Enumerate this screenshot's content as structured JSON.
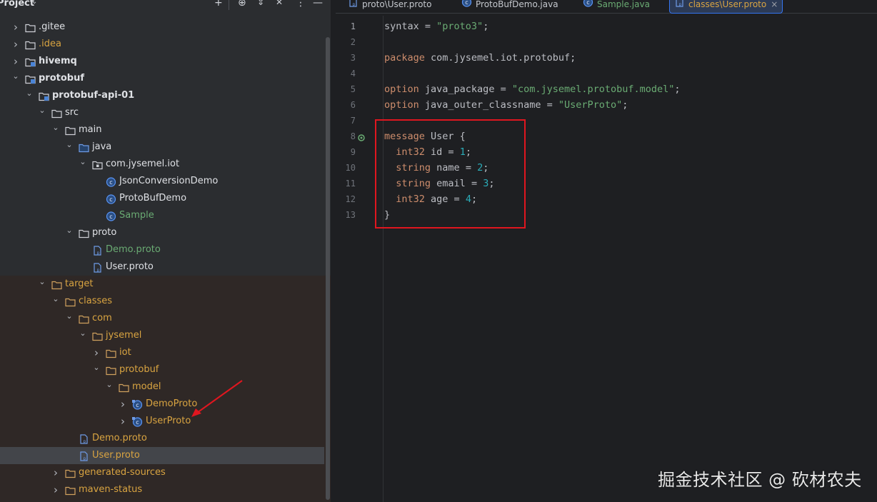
{
  "project_panel": {
    "title": "Project",
    "header_icons": [
      "add-icon",
      "target-icon",
      "expand-all-icon",
      "collapse-all-icon",
      "more-icon",
      "minimize-icon"
    ]
  },
  "tree": [
    {
      "label": ".gitee",
      "icon": "folder-icon",
      "expanded": false,
      "bold": false,
      "color": "#dfe1e5"
    },
    {
      "label": ".idea",
      "icon": "folder-icon",
      "expanded": false,
      "bold": false,
      "color": "#d9a441"
    },
    {
      "label": "hivemq",
      "icon": "module-folder-icon",
      "expanded": false,
      "bold": true,
      "color": "#dfe1e5"
    },
    {
      "label": "protobuf",
      "icon": "module-folder-icon",
      "expanded": true,
      "bold": true,
      "color": "#dfe1e5"
    },
    {
      "label": "protobuf-api-01",
      "icon": "module-folder-icon",
      "expanded": true,
      "bold": true,
      "color": "#dfe1e5"
    },
    {
      "label": "src",
      "icon": "folder-icon",
      "expanded": true,
      "bold": false,
      "color": "#dfe1e5"
    },
    {
      "label": "main",
      "icon": "folder-icon",
      "expanded": true,
      "bold": false,
      "color": "#dfe1e5"
    },
    {
      "label": "java",
      "icon": "source-folder-icon",
      "expanded": true,
      "bold": false,
      "color": "#dfe1e5"
    },
    {
      "label": "com.jysemel.iot",
      "icon": "package-icon",
      "expanded": true,
      "bold": false,
      "color": "#dfe1e5"
    },
    {
      "label": "JsonConversionDemo",
      "icon": "java-class-icon",
      "bold": false,
      "color": "#dfe1e5"
    },
    {
      "label": "ProtoBufDemo",
      "icon": "java-class-icon",
      "bold": false,
      "color": "#dfe1e5"
    },
    {
      "label": "Sample",
      "icon": "java-class-icon",
      "bold": false,
      "color": "#6aab73"
    },
    {
      "label": "proto",
      "icon": "folder-icon",
      "expanded": true,
      "bold": false,
      "color": "#dfe1e5"
    },
    {
      "label": "Demo.proto",
      "icon": "proto-file-icon",
      "bold": false,
      "color": "#6aab73"
    },
    {
      "label": "User.proto",
      "icon": "proto-file-icon",
      "bold": false,
      "color": "#dfe1e5"
    },
    {
      "label": "target",
      "icon": "excluded-folder-icon",
      "expanded": true,
      "bold": false,
      "color": "#d9a441"
    },
    {
      "label": "classes",
      "icon": "excluded-folder-icon",
      "expanded": true,
      "bold": false,
      "color": "#d9a441"
    },
    {
      "label": "com",
      "icon": "excluded-folder-icon",
      "expanded": true,
      "bold": false,
      "color": "#d9a441"
    },
    {
      "label": "jysemel",
      "icon": "excluded-folder-icon",
      "expanded": true,
      "bold": false,
      "color": "#d9a441"
    },
    {
      "label": "iot",
      "icon": "excluded-folder-icon",
      "expanded": false,
      "bold": false,
      "color": "#d9a441"
    },
    {
      "label": "protobuf",
      "icon": "excluded-folder-icon",
      "expanded": true,
      "bold": false,
      "color": "#d9a441"
    },
    {
      "label": "model",
      "icon": "excluded-folder-icon",
      "expanded": true,
      "bold": false,
      "color": "#d9a441"
    },
    {
      "label": "DemoProto",
      "icon": "class-file-icon",
      "expanded": false,
      "bold": false,
      "color": "#d9a441"
    },
    {
      "label": "UserProto",
      "icon": "class-file-icon",
      "expanded": false,
      "bold": false,
      "color": "#d9a441"
    },
    {
      "label": "Demo.proto",
      "icon": "proto-file-icon",
      "bold": false,
      "color": "#d9a441"
    },
    {
      "label": "User.proto",
      "icon": "proto-file-icon",
      "bold": false,
      "color": "#d9a441",
      "selected": true
    },
    {
      "label": "generated-sources",
      "icon": "excluded-folder-icon",
      "expanded": false,
      "bold": false,
      "color": "#d9a441"
    },
    {
      "label": "maven-status",
      "icon": "excluded-folder-icon",
      "expanded": false,
      "bold": false,
      "color": "#d9a441"
    }
  ],
  "editor_tabs": [
    {
      "label": "proto\\User.proto",
      "icon": "proto-file-icon",
      "color": "#c5c8ce",
      "active": false
    },
    {
      "label": "ProtoBufDemo.java",
      "icon": "java-class-icon",
      "color": "#c5c8ce",
      "active": false
    },
    {
      "label": "Sample.java",
      "icon": "java-class-icon",
      "color": "#6aab73",
      "active": false
    },
    {
      "label": "classes\\User.proto",
      "icon": "proto-file-icon",
      "color": "#d9a441",
      "active": true,
      "close": "×"
    }
  ],
  "code_lines": [
    {
      "n": "1",
      "tokens": [
        [
          "t",
          "syntax = "
        ],
        [
          "s",
          "\"proto3\""
        ],
        [
          "t",
          ";"
        ]
      ]
    },
    {
      "n": "2",
      "tokens": []
    },
    {
      "n": "3",
      "tokens": [
        [
          "k",
          "package"
        ],
        [
          "t",
          " com.jysemel.iot.protobuf;"
        ]
      ]
    },
    {
      "n": "4",
      "tokens": []
    },
    {
      "n": "5",
      "tokens": [
        [
          "k",
          "option"
        ],
        [
          "t",
          " java_package = "
        ],
        [
          "s",
          "\"com.jysemel.protobuf.model\""
        ],
        [
          "t",
          ";"
        ]
      ]
    },
    {
      "n": "6",
      "tokens": [
        [
          "k",
          "option"
        ],
        [
          "t",
          " java_outer_classname = "
        ],
        [
          "s",
          "\"UserProto\""
        ],
        [
          "t",
          ";"
        ]
      ]
    },
    {
      "n": "7",
      "tokens": []
    },
    {
      "n": "8",
      "tokens": [
        [
          "k",
          "message"
        ],
        [
          "t",
          " User {"
        ]
      ],
      "gutter_icon": "implemented-icon"
    },
    {
      "n": "9",
      "tokens": [
        [
          "t",
          "  "
        ],
        [
          "k",
          "int32"
        ],
        [
          "t",
          " id = "
        ],
        [
          "n",
          "1"
        ],
        [
          "t",
          ";"
        ]
      ]
    },
    {
      "n": "10",
      "tokens": [
        [
          "t",
          "  "
        ],
        [
          "k",
          "string"
        ],
        [
          "t",
          " name = "
        ],
        [
          "n",
          "2"
        ],
        [
          "t",
          ";"
        ]
      ]
    },
    {
      "n": "11",
      "tokens": [
        [
          "t",
          "  "
        ],
        [
          "k",
          "string"
        ],
        [
          "t",
          " email = "
        ],
        [
          "n",
          "3"
        ],
        [
          "t",
          ";"
        ]
      ]
    },
    {
      "n": "12",
      "tokens": [
        [
          "t",
          "  "
        ],
        [
          "k",
          "int32"
        ],
        [
          "t",
          " age = "
        ],
        [
          "n",
          "4"
        ],
        [
          "t",
          ";"
        ]
      ]
    },
    {
      "n": "13",
      "tokens": [
        [
          "t",
          "}"
        ]
      ]
    }
  ],
  "watermark": "掘金技术社区 @ 砍材农夫",
  "colors": {
    "keyword": "#cf8e6d",
    "string": "#6aab73",
    "number": "#2aacb8",
    "text": "#bcbec4",
    "excluded": "#d9a441",
    "annotation_red": "#e0161f"
  }
}
